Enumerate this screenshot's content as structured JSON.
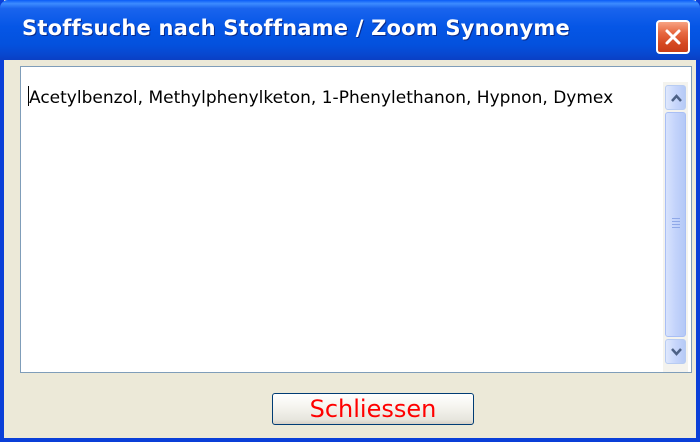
{
  "window": {
    "title": "Stoffsuche nach Stoffname / Zoom Synonyme"
  },
  "content": {
    "synonyms_text": "Acetylbenzol, Methylphenylketon, 1-Phenylethanon, Hypnon, Dymex"
  },
  "buttons": {
    "close_label": "Schliessen"
  },
  "colors": {
    "titlebar": "#0556e6",
    "window_bg": "#ece9d8",
    "close_label_text": "#ff0000"
  },
  "icons": {
    "close": "close-icon",
    "scroll_up": "chevron-up-icon",
    "scroll_down": "chevron-down-icon"
  }
}
